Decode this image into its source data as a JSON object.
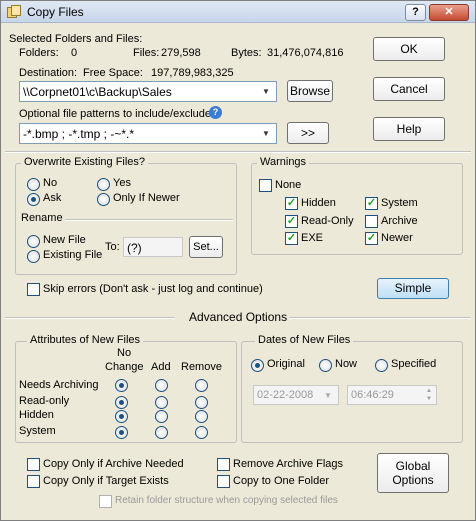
{
  "window": {
    "title": "Copy Files"
  },
  "summary": {
    "heading": "Selected Folders and Files:",
    "folders_label": "Folders:",
    "folders_value": "0",
    "files_label": "Files:",
    "files_value": "279,598",
    "bytes_label": "Bytes:",
    "bytes_value": "31,476,074,816",
    "destination_label": "Destination:",
    "free_space_label": "Free Space:",
    "free_space_value": "197,789,983,325"
  },
  "destination": {
    "value": "\\\\Corpnet01\\c\\Backup\\Sales",
    "browse_label": "Browse"
  },
  "patterns": {
    "label": "Optional file patterns to include/exclude:",
    "value": "-*.bmp ; -*.tmp ; -~*.*",
    "apply_label": ">>"
  },
  "buttons": {
    "ok": "OK",
    "cancel": "Cancel",
    "help": "Help",
    "simple": "Simple",
    "global_options": [
      "Global",
      "Options"
    ]
  },
  "overwrite": {
    "title": "Overwrite Existing Files?",
    "options": [
      {
        "label": "No",
        "selected": false
      },
      {
        "label": "Ask",
        "selected": true
      },
      {
        "label": "Yes",
        "selected": false
      },
      {
        "label": "Only If Newer",
        "selected": false
      }
    ]
  },
  "rename": {
    "title": "Rename",
    "options": [
      {
        "label": "New File",
        "selected": false
      },
      {
        "label": "Existing File",
        "selected": false
      }
    ],
    "to_label": "To:",
    "to_value": "(?)",
    "set_label": "Set..."
  },
  "warnings": {
    "title": "Warnings",
    "items": [
      {
        "label": "None",
        "checked": false
      },
      {
        "label": "Hidden",
        "checked": true
      },
      {
        "label": "System",
        "checked": true
      },
      {
        "label": "Read-Only",
        "checked": true
      },
      {
        "label": "Archive",
        "checked": false
      },
      {
        "label": "EXE",
        "checked": true
      },
      {
        "label": "Newer",
        "checked": true
      }
    ]
  },
  "skip_errors": {
    "label": "Skip errors (Don't ask - just log and continue)",
    "checked": false
  },
  "advanced": {
    "title": "Advanced Options",
    "attributes": {
      "title": "Attributes of New Files",
      "columns": [
        "No",
        "Change",
        "Add",
        "Remove"
      ],
      "rows": [
        {
          "label": "Needs Archiving",
          "selected": "No Change"
        },
        {
          "label": "Read-only",
          "selected": "No Change"
        },
        {
          "label": "Hidden",
          "selected": "No Change"
        },
        {
          "label": "System",
          "selected": "No Change"
        }
      ]
    },
    "dates": {
      "title": "Dates of New Files",
      "options": [
        {
          "label": "Original",
          "selected": true
        },
        {
          "label": "Now",
          "selected": false
        },
        {
          "label": "Specified",
          "selected": false
        }
      ],
      "date_value": "02-22-2008",
      "time_value": "06:46:29"
    },
    "checks": [
      {
        "label": "Copy Only if Archive Needed",
        "checked": false
      },
      {
        "label": "Remove Archive Flags",
        "checked": false
      },
      {
        "label": "Copy Only if Target Exists",
        "checked": false
      },
      {
        "label": "Copy to One Folder",
        "checked": false
      },
      {
        "label": "Retain folder structure when copying selected files",
        "checked": false,
        "disabled": true
      }
    ]
  },
  "colors": {
    "accent": "#1c5180",
    "check_mark": "#21a121",
    "dialog_bg": "#ece9d8"
  }
}
